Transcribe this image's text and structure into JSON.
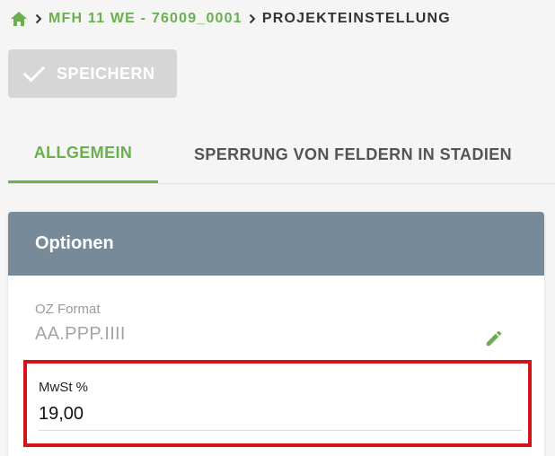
{
  "breadcrumb": {
    "home_icon": "home-icon",
    "separator_icon": "chevron-right-icon",
    "project": "MFH 11 WE - 76009_0001",
    "current": "PROJEKTEINSTELLUNG"
  },
  "toolbar": {
    "save_label": "SPEICHERN",
    "save_icon": "check-icon",
    "save_state": "disabled"
  },
  "tabs": [
    {
      "label": "ALLGEMEIN",
      "active": true
    },
    {
      "label": "SPERRUNG VON FELDERN IN STADIEN",
      "active": false
    }
  ],
  "options": {
    "title": "Optionen",
    "fields": {
      "oz_format": {
        "label": "OZ Format",
        "value": "AA.PPP.IIII",
        "edit_icon": "pencil-icon"
      },
      "mwst": {
        "label": "MwSt %",
        "value": "19,00"
      }
    }
  },
  "colors": {
    "accent_green": "#6ab04c",
    "card_header": "#778a99",
    "highlight_red": "#d0141a",
    "button_disabled": "#d6d6d6"
  }
}
